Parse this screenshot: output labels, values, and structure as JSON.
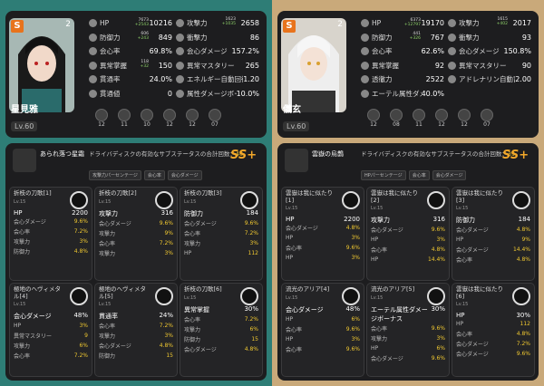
{
  "left": {
    "count": "2",
    "name": "星見雅",
    "level": "Lv.60",
    "stats": [
      [
        {
          "label": "HP",
          "value": "10216",
          "sub1": "7673",
          "sub2": "+2543",
          "icon": "hp-icon"
        },
        {
          "label": "攻撃力",
          "value": "2658",
          "sub1": "1623",
          "sub2": "+1035",
          "icon": "attack-icon"
        }
      ],
      [
        {
          "label": "防御力",
          "value": "849",
          "sub1": "606",
          "sub2": "+243",
          "icon": "defense-icon"
        },
        {
          "label": "衝撃力",
          "value": "86",
          "icon": "impact-icon"
        }
      ],
      [
        {
          "label": "会心率",
          "value": "69.8%",
          "icon": "crit-rate-icon"
        },
        {
          "label": "会心ダメージ",
          "value": "157.2%",
          "icon": "crit-dmg-icon"
        }
      ],
      [
        {
          "label": "異常掌握",
          "value": "150",
          "sub1": "118",
          "sub2": "+32",
          "icon": "anomaly-mastery-icon"
        },
        {
          "label": "異常マスタリー",
          "value": "265",
          "icon": "anomaly-proficiency-icon"
        }
      ],
      [
        {
          "label": "貫通率",
          "value": "24.0%",
          "icon": "pen-ratio-icon"
        },
        {
          "label": "エネルギー自動回復",
          "value": "1.20",
          "icon": "energy-regen-icon"
        }
      ],
      [
        {
          "label": "貫通値",
          "value": "0",
          "icon": "pen-icon"
        },
        {
          "label": "属性ダメージボーナス",
          "value": "10.0%",
          "icon": "element-bonus-icon"
        }
      ]
    ],
    "chips": [
      "12",
      "11",
      "10",
      "12",
      "12",
      "07"
    ],
    "disc": {
      "title": "あられ落つ星霜",
      "main_label": "ドライバディスクの有効なサブステータスの合計回数：",
      "main_value": "40",
      "grade": "SS+",
      "tags": [
        "攻撃力パーセンテージ",
        "会心率",
        "会心ダメージ"
      ],
      "cards": [
        {
          "title": "折枝の刀歌[1]",
          "lv": "Lv.15",
          "main_label": "HP",
          "main_value": "2200",
          "subs": [
            [
              "会心ダメージ",
              "9.6%"
            ],
            [
              "会心率",
              "7.2%"
            ],
            [
              "攻撃力",
              "3%"
            ],
            [
              "防御力",
              "4.8%"
            ]
          ]
        },
        {
          "title": "折枝の刀歌[2]",
          "lv": "Lv.15",
          "main_label": "攻撃力",
          "main_value": "316",
          "subs": [
            [
              "会心ダメージ",
              "9.6%"
            ],
            [
              "攻撃力",
              "9%"
            ],
            [
              "会心率",
              "7.2%"
            ],
            [
              "攻撃力",
              "3%"
            ]
          ]
        },
        {
          "title": "折枝の刀歌[3]",
          "lv": "Lv.15",
          "main_label": "防御力",
          "main_value": "184",
          "subs": [
            [
              "会心ダメージ",
              "9.6%"
            ],
            [
              "会心率",
              "7.2%"
            ],
            [
              "攻撃力",
              "3%"
            ],
            [
              "HP",
              "112"
            ]
          ]
        },
        {
          "title": "極地のヘヴィメタル[4]",
          "lv": "Lv.15",
          "main_label": "会心ダメージ",
          "main_value": "48%",
          "subs": [
            [
              "HP",
              "3%"
            ],
            [
              "異常マスタリー",
              "9"
            ],
            [
              "攻撃力",
              "6%"
            ],
            [
              "会心率",
              "7.2%"
            ]
          ]
        },
        {
          "title": "極地のヘヴィメタル[5]",
          "lv": "Lv.15",
          "main_label": "貫通率",
          "main_value": "24%",
          "subs": [
            [
              "会心率",
              "7.2%"
            ],
            [
              "攻撃力",
              "3%"
            ],
            [
              "会心ダメージ",
              "4.8%"
            ],
            [
              "防御力",
              "15"
            ]
          ]
        },
        {
          "title": "折枝の刀歌[6]",
          "lv": "Lv.15",
          "main_label": "異常掌握",
          "main_value": "30%",
          "subs": [
            [
              "会心率",
              "7.2%"
            ],
            [
              "攻撃力",
              "6%"
            ],
            [
              "防御力",
              "15"
            ],
            [
              "会心ダメージ",
              "4.8%"
            ]
          ]
        }
      ]
    }
  },
  "right": {
    "count": "2",
    "name": "儀玄",
    "level": "Lv.60",
    "stats": [
      [
        {
          "label": "HP",
          "value": "19170",
          "sub1": "6373",
          "sub2": "+12797",
          "icon": "hp-icon"
        },
        {
          "label": "攻撃力",
          "value": "2017",
          "sub1": "1615",
          "sub2": "+402",
          "icon": "attack-icon"
        }
      ],
      [
        {
          "label": "防御力",
          "value": "767",
          "sub1": "441",
          "sub2": "+326",
          "icon": "defense-icon"
        },
        {
          "label": "衝撃力",
          "value": "93",
          "icon": "impact-icon"
        }
      ],
      [
        {
          "label": "会心率",
          "value": "62.6%",
          "icon": "crit-rate-icon"
        },
        {
          "label": "会心ダメージ",
          "value": "150.8%",
          "icon": "crit-dmg-icon"
        }
      ],
      [
        {
          "label": "異常掌握",
          "value": "92",
          "icon": "anomaly-mastery-icon"
        },
        {
          "label": "異常マスタリー",
          "value": "90",
          "icon": "anomaly-proficiency-icon"
        }
      ],
      [
        {
          "label": "透徹力",
          "value": "2522",
          "icon": "sheer-force-icon"
        },
        {
          "label": "アドレナリン自動蓄積",
          "value": "2.00",
          "icon": "adrenaline-icon"
        }
      ],
      [
        {
          "label": "エーテル属性ダメージボーナス",
          "value": "40.0%",
          "icon": "ether-bonus-icon"
        },
        {
          "label": "",
          "value": "",
          "icon": ""
        }
      ]
    ],
    "chips": [
      "12",
      "08",
      "11",
      "12",
      "12",
      "07"
    ],
    "disc": {
      "title": "雲嶽の烏鵲",
      "main_label": "ドライバディスクの有効なサブステータスの合計回数：",
      "main_value": "39",
      "grade": "SS+",
      "tags": [
        "HPパーセンテージ",
        "会心率",
        "会心ダメージ"
      ],
      "cards": [
        {
          "title": "雲嶽は我に似たり[1]",
          "lv": "Lv.15",
          "main_label": "HP",
          "main_value": "2200",
          "subs": [
            [
              "会心ダメージ",
              "4.8%"
            ],
            [
              "HP",
              "3%"
            ],
            [
              "会心率",
              "9.6%"
            ],
            [
              "HP",
              "3%"
            ]
          ]
        },
        {
          "title": "雲嶽は我に似たり[2]",
          "lv": "Lv.15",
          "main_label": "攻撃力",
          "main_value": "316",
          "subs": [
            [
              "会心ダメージ",
              "9.6%"
            ],
            [
              "HP",
              "3%"
            ],
            [
              "会心率",
              "4.8%"
            ],
            [
              "HP",
              "14.4%"
            ]
          ]
        },
        {
          "title": "雲嶽は我に似たり[3]",
          "lv": "Lv.15",
          "main_label": "防御力",
          "main_value": "184",
          "subs": [
            [
              "会心ダメージ",
              "4.8%"
            ],
            [
              "HP",
              "9%"
            ],
            [
              "会心ダメージ",
              "14.4%"
            ],
            [
              "会心率",
              "4.8%"
            ]
          ]
        },
        {
          "title": "流光のアリア[4]",
          "lv": "Lv.15",
          "main_label": "会心ダメージ",
          "main_value": "48%",
          "subs": [
            [
              "HP",
              "6%"
            ],
            [
              "会心率",
              "9.6%"
            ],
            [
              "HP",
              "3%"
            ],
            [
              "会心率",
              "9.6%"
            ]
          ]
        },
        {
          "title": "流光のアリア[5]",
          "lv": "Lv.15",
          "main_label": "エーテル属性ダメージボーナス",
          "main_value": "30%",
          "subs": [
            [
              "会心率",
              "9.6%"
            ],
            [
              "攻撃力",
              "3%"
            ],
            [
              "HP",
              "6%"
            ],
            [
              "会心ダメージ",
              "9.6%"
            ]
          ]
        },
        {
          "title": "雲嶽は我に似たり[6]",
          "lv": "Lv.15",
          "main_label": "HP",
          "main_value": "30%",
          "subs": [
            [
              "HP",
              "112"
            ],
            [
              "会心率",
              "4.8%"
            ],
            [
              "会心ダメージ",
              "7.2%"
            ],
            [
              "会心ダメージ",
              "9.6%"
            ]
          ]
        }
      ]
    }
  }
}
